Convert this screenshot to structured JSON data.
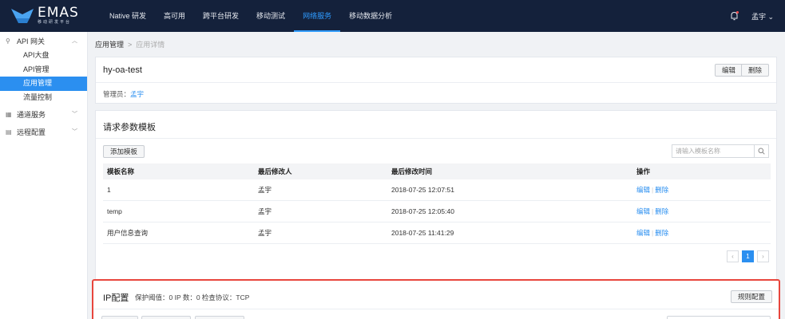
{
  "colors": {
    "topbar": "#14213b",
    "accent": "#2b8ff0",
    "highlight_border": "#e8463d"
  },
  "header": {
    "logo_text": "EMAS",
    "logo_sub": "移动研发平台",
    "nav": [
      {
        "label": "Native 研发"
      },
      {
        "label": "高可用"
      },
      {
        "label": "跨平台研发"
      },
      {
        "label": "移动测试"
      },
      {
        "label": "网络服务",
        "active": true
      },
      {
        "label": "移动数据分析"
      }
    ],
    "user": "孟宇 ⌄"
  },
  "sidebar": {
    "group_api": "API 网关",
    "items": [
      "API大盘",
      "API管理",
      "应用管理",
      "流量控制"
    ],
    "group_channel": "通道服务",
    "group_remote": "远程配置"
  },
  "breadcrumb": {
    "root": "应用管理",
    "sep": ">",
    "current": "应用详情"
  },
  "app": {
    "name": "hy-oa-test",
    "edit_label": "编辑",
    "delete_label": "删除",
    "admin_label": "管理员：",
    "admin_name": "孟宇"
  },
  "templates": {
    "title": "请求参数模板",
    "add_label": "添加模板",
    "search_placeholder": "请输入模板名称",
    "columns": [
      "模板名称",
      "最后修改人",
      "最后修改时间",
      "操作"
    ],
    "rows": [
      {
        "name": "1",
        "modifier": "孟宇",
        "time": "2018-07-25 12:07:51"
      },
      {
        "name": "temp",
        "modifier": "孟宇",
        "time": "2018-07-25 12:05:40"
      },
      {
        "name": "用户信息查询",
        "modifier": "孟宇",
        "time": "2018-07-25 11:41:29"
      }
    ],
    "action_edit": "编辑",
    "action_delete": "删除",
    "pager": {
      "prev": "‹",
      "current": "1",
      "next": "›"
    }
  },
  "ip_config": {
    "title": "IP配置",
    "info": "保护阈值：0   IP 数：0   检查协议：TCP",
    "rule_label": "规则配置"
  }
}
